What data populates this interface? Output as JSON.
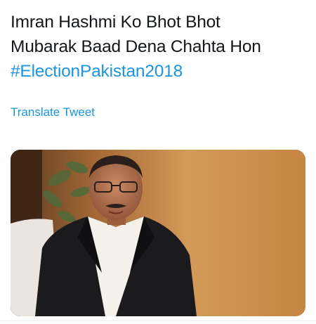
{
  "tweet": {
    "line1": "Imran Hashmi Ko Bhot Bhot",
    "line2": "Mubarak Baad Dena Chahta Hon",
    "hashtag": "#ElectionPakistan2018",
    "translate_label": "Translate Tweet"
  },
  "colors": {
    "text": "#14171a",
    "link": "#1b95e0",
    "background": "#ffffff"
  }
}
